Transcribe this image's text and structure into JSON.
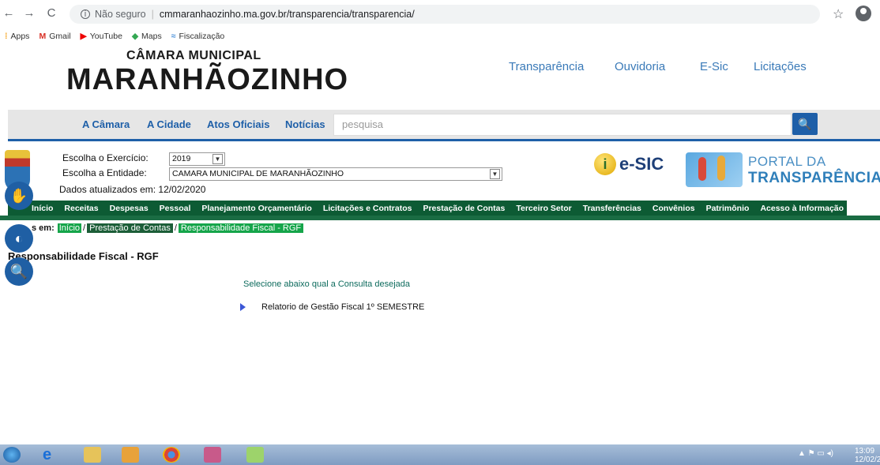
{
  "browser": {
    "back": "←",
    "forward": "→",
    "reload": "C",
    "security": "Não seguro",
    "url": "cmmaranhaozinho.ma.gov.br/transparencia/transparencia/",
    "bookmarks": [
      "Apps",
      "Gmail",
      "YouTube",
      "Maps",
      "Fiscalização"
    ]
  },
  "header": {
    "small": "CÂMARA MUNICIPAL",
    "big": "MARANHÃOZINHO",
    "topnav": [
      "Transparência",
      "Ouvidoria",
      "E-Sic",
      "Licitações"
    ]
  },
  "menu": {
    "items": [
      "A Câmara",
      "A Cidade",
      "Atos Oficiais",
      "Notícias"
    ],
    "search_placeholder": "pesquisa"
  },
  "portal": {
    "exercicio_label": "Escolha o Exercício:",
    "exercicio_value": "2019",
    "entidade_label": "Escolha a Entidade:",
    "entidade_value": "CAMARA MUNICIPAL DE MARANHÃOZINHO",
    "updated": "Dados atualizados em: 12/02/2020",
    "esic": "e-SIC",
    "pt_line1": "PORTAL DA",
    "pt_line2": "TRANSPARÊNCIA",
    "nav": [
      "Início",
      "Receitas",
      "Despesas",
      "Pessoal",
      "Planejamento Orçamentário",
      "Licitações e Contratos",
      "Prestação de Contas",
      "Terceiro Setor",
      "Transferências",
      "Convênios",
      "Patrimônio",
      "Acesso à Informação"
    ],
    "crumb_label": "s em:",
    "crumbs": [
      "Início",
      "Prestação de Contas",
      "Responsabilidade Fiscal - RGF"
    ],
    "title": "Responsabilidade Fiscal - RGF",
    "select_text": "Selecione abaixo qual a Consulta desejada",
    "item": "Relatorio de Gestão Fiscal 1º SEMESTRE"
  },
  "taskbar": {
    "time": "13:09",
    "date": "12/02/202"
  },
  "colors": {
    "menu_blue": "#1e5fa8",
    "portal_green": "#0d5b34",
    "crumb_green": "#15a54a"
  }
}
